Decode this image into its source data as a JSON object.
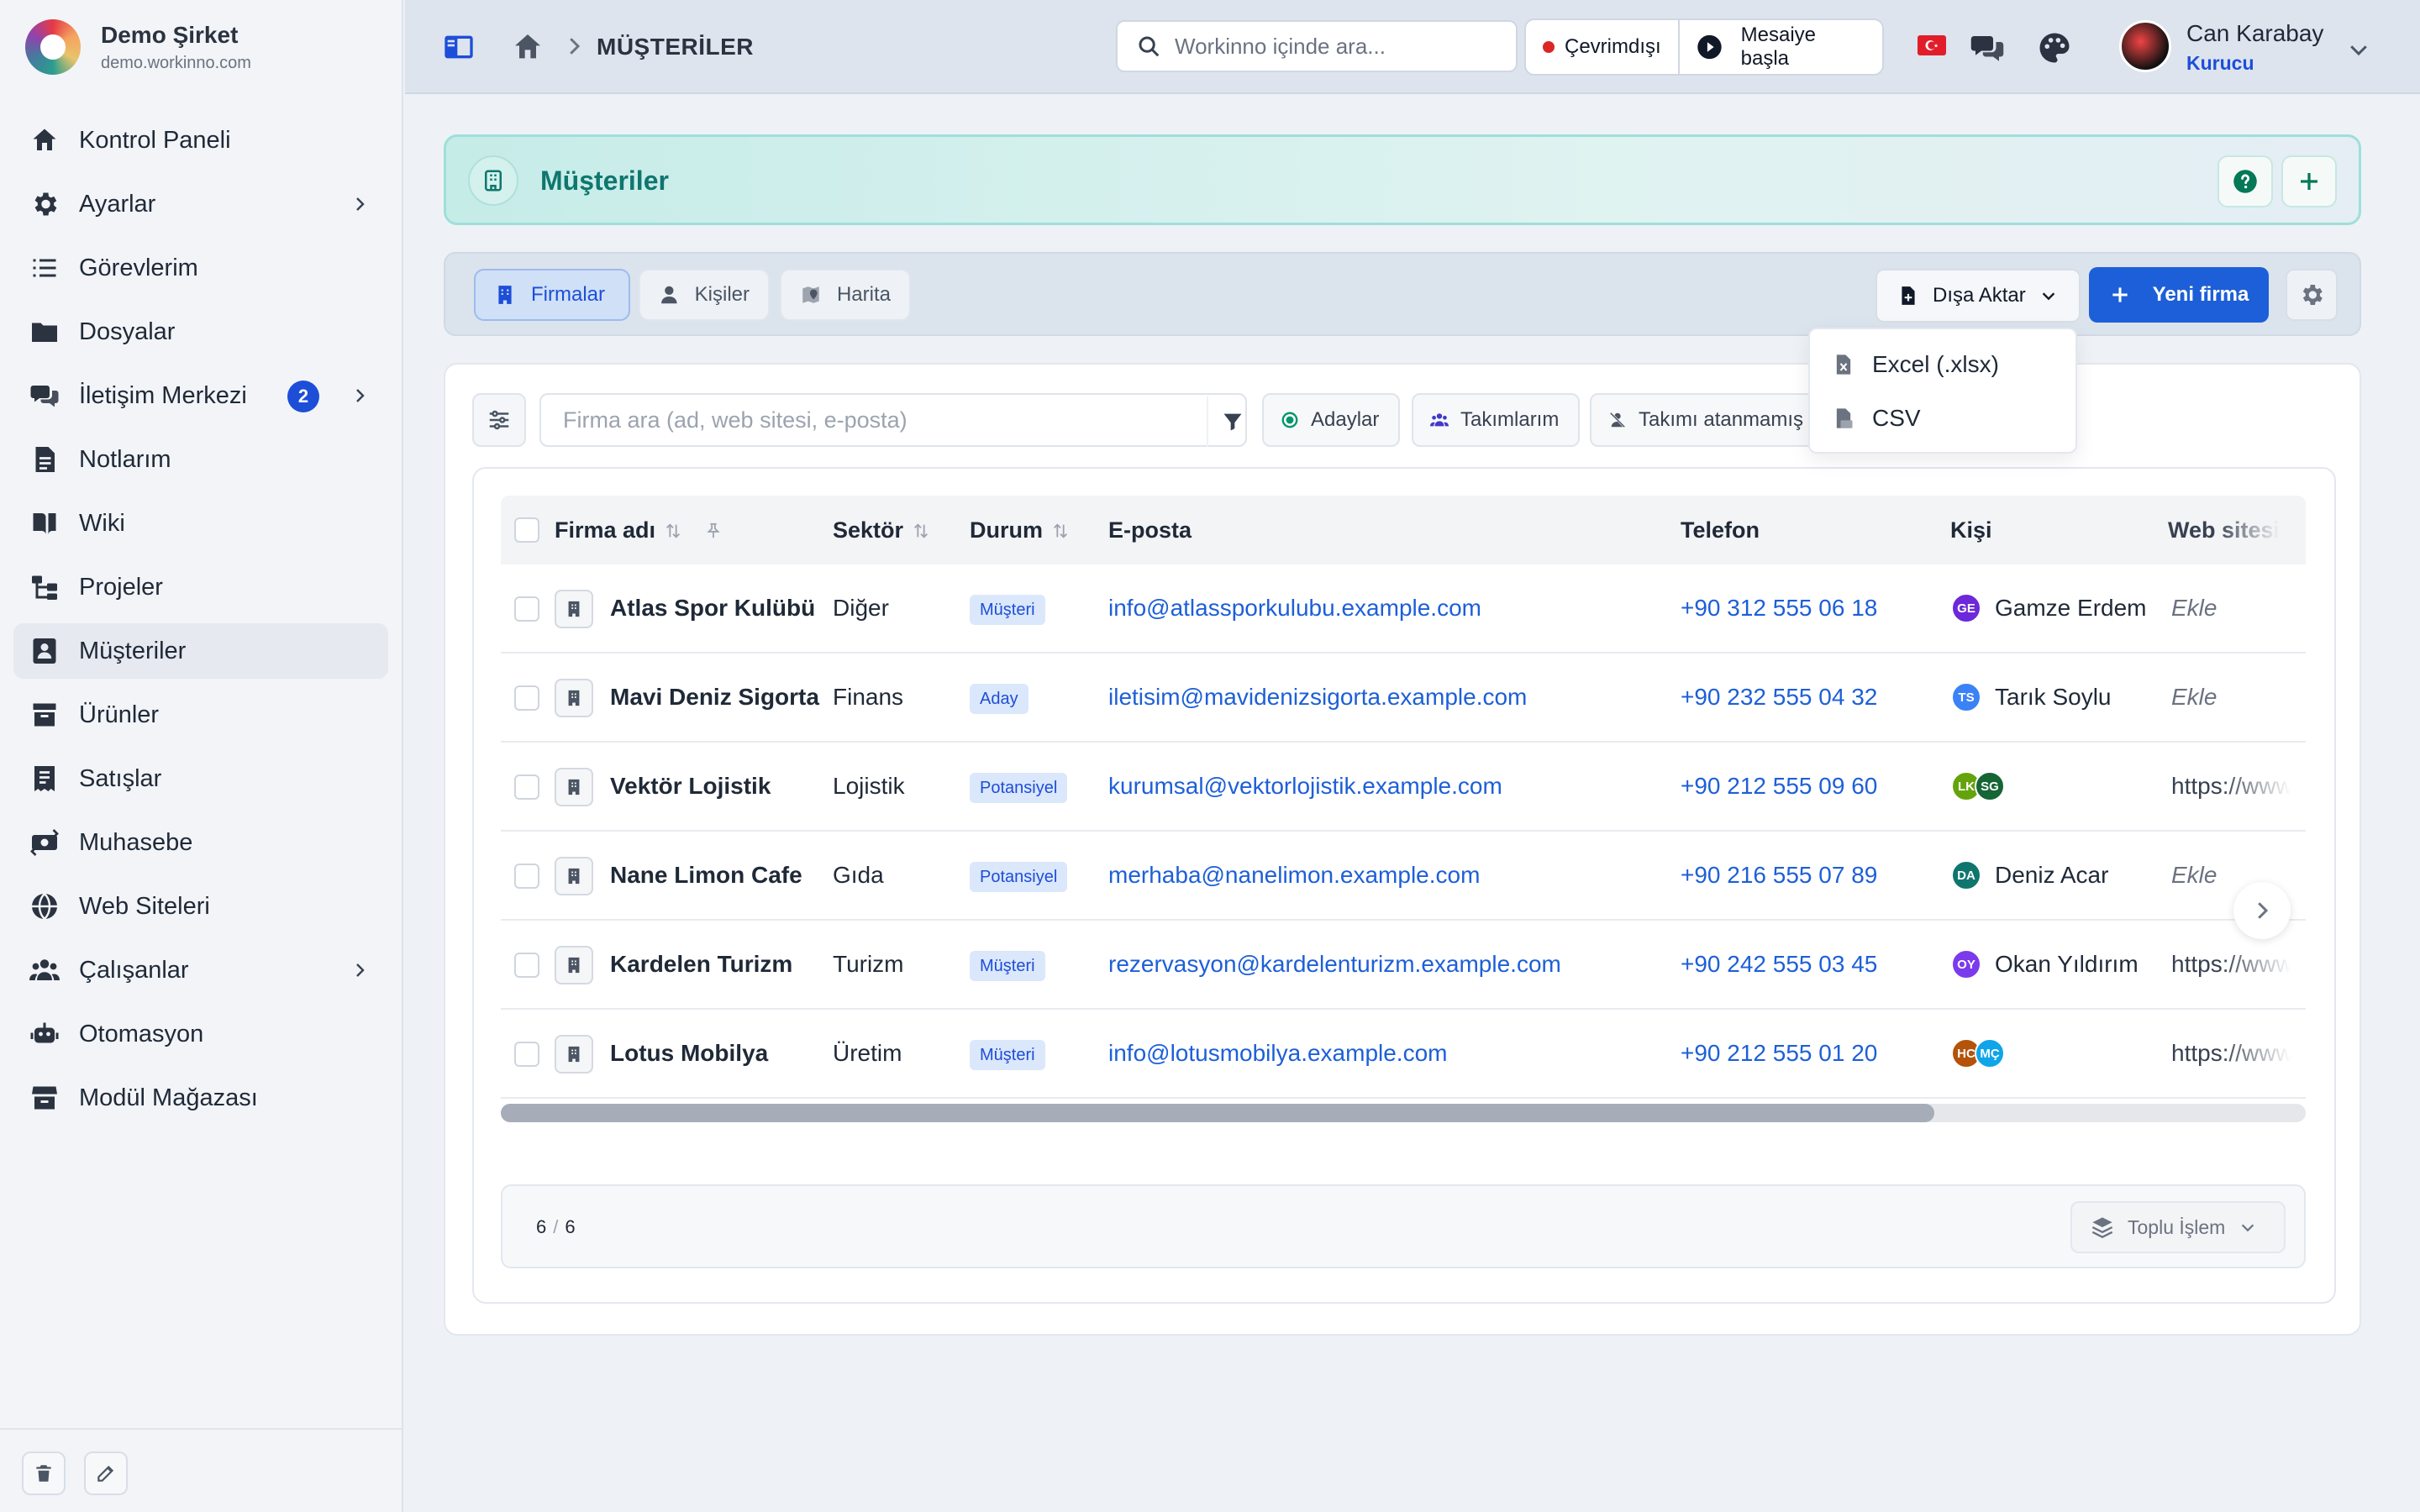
{
  "brand": {
    "name": "Demo Şirket",
    "url": "demo.workinno.com"
  },
  "sidebar": {
    "items": [
      {
        "label": "Kontrol Paneli",
        "icon": "home-icon"
      },
      {
        "label": "Ayarlar",
        "icon": "gear-icon",
        "has_submenu": true
      },
      {
        "label": "Görevlerim",
        "icon": "tasks-list-icon"
      },
      {
        "label": "Dosyalar",
        "icon": "folder-icon"
      },
      {
        "label": "İletişim Merkezi",
        "icon": "chat-icon",
        "badge": "2",
        "has_submenu": true
      },
      {
        "label": "Notlarım",
        "icon": "note-icon"
      },
      {
        "label": "Wiki",
        "icon": "book-icon"
      },
      {
        "label": "Projeler",
        "icon": "project-tree-icon"
      },
      {
        "label": "Müşteriler",
        "icon": "contact-card-icon",
        "active": true
      },
      {
        "label": "Ürünler",
        "icon": "box-icon"
      },
      {
        "label": "Satışlar",
        "icon": "receipt-icon"
      },
      {
        "label": "Muhasebe",
        "icon": "money-icon"
      },
      {
        "label": "Web Siteleri",
        "icon": "globe-icon"
      },
      {
        "label": "Çalışanlar",
        "icon": "users-icon",
        "has_submenu": true
      },
      {
        "label": "Otomasyon",
        "icon": "robot-icon"
      },
      {
        "label": "Modül Mağazası",
        "icon": "store-icon"
      }
    ]
  },
  "topbar": {
    "breadcrumb": "MÜŞTERİLER",
    "search_placeholder": "Workinno içinde ara...",
    "status_label": "Çevrimdışı",
    "shift_label": "Mesaiye başla",
    "user": {
      "name": "Can Karabay",
      "role": "Kurucu"
    }
  },
  "page": {
    "title": "Müşteriler"
  },
  "tabs": [
    {
      "label": "Firmalar",
      "icon": "building-icon",
      "active": true
    },
    {
      "label": "Kişiler",
      "icon": "person-icon"
    },
    {
      "label": "Harita",
      "icon": "map-pin-icon"
    }
  ],
  "actions": {
    "export_label": "Dışa Aktar",
    "new_label": "Yeni firma",
    "export_menu": [
      "Excel (.xlsx)",
      "CSV"
    ]
  },
  "filters": {
    "search_placeholder": "Firma ara (ad, web sitesi, e-posta)",
    "chips": [
      "Adaylar",
      "Takımlarım",
      "Takımı atanmamış"
    ]
  },
  "table": {
    "columns": [
      "Firma adı",
      "Sektör",
      "Durum",
      "E-posta",
      "Telefon",
      "Kişi",
      "Web sitesi"
    ],
    "rows": [
      {
        "name": "Atlas Spor Kulübü",
        "sector": "Diğer",
        "status": "Müşteri",
        "email": "info@atlassporkulubu.example.com",
        "phone": "+90 312 555 06 18",
        "contacts": [
          {
            "initials": "GE",
            "color": "#6d28d9"
          }
        ],
        "contact_name": "Gamze Erdem",
        "website": "Ekle",
        "website_empty": true
      },
      {
        "name": "Mavi Deniz Sigorta",
        "sector": "Finans",
        "status": "Aday",
        "email": "iletisim@mavidenizsigorta.example.com",
        "phone": "+90 232 555 04 32",
        "contacts": [
          {
            "initials": "TS",
            "color": "#3b82f6"
          }
        ],
        "contact_name": "Tarık Soylu",
        "website": "Ekle",
        "website_empty": true
      },
      {
        "name": "Vektör Lojistik",
        "sector": "Lojistik",
        "status": "Potansiyel",
        "email": "kurumsal@vektorlojistik.example.com",
        "phone": "+90 212 555 09 60",
        "contacts": [
          {
            "initials": "LK",
            "color": "#65a30d"
          },
          {
            "initials": "SG",
            "color": "#166534"
          }
        ],
        "contact_name": "",
        "website": "https://www",
        "website_empty": false
      },
      {
        "name": "Nane Limon Cafe",
        "sector": "Gıda",
        "status": "Potansiyel",
        "email": "merhaba@nanelimon.example.com",
        "phone": "+90 216 555 07 89",
        "contacts": [
          {
            "initials": "DA",
            "color": "#0f766e"
          }
        ],
        "contact_name": "Deniz Acar",
        "website": "Ekle",
        "website_empty": true
      },
      {
        "name": "Kardelen Turizm",
        "sector": "Turizm",
        "status": "Müşteri",
        "email": "rezervasyon@kardelenturizm.example.com",
        "phone": "+90 242 555 03 45",
        "contacts": [
          {
            "initials": "OY",
            "color": "#7c3aed"
          }
        ],
        "contact_name": "Okan Yıldırım",
        "website": "https://www",
        "website_empty": false
      },
      {
        "name": "Lotus Mobilya",
        "sector": "Üretim",
        "status": "Müşteri",
        "email": "info@lotusmobilya.example.com",
        "phone": "+90 212 555 01 20",
        "contacts": [
          {
            "initials": "HC",
            "color": "#b45309"
          },
          {
            "initials": "MÇ",
            "color": "#0ea5e9"
          }
        ],
        "contact_name": "",
        "website": "https://www",
        "website_empty": false
      }
    ]
  },
  "pagination": {
    "shown": "6",
    "total": "6"
  },
  "bulk_label": "Toplu İşlem",
  "colors": {
    "accent": "#1d5fd8",
    "teal": "#0f766e",
    "badge_bg": "#dbe7fb"
  }
}
